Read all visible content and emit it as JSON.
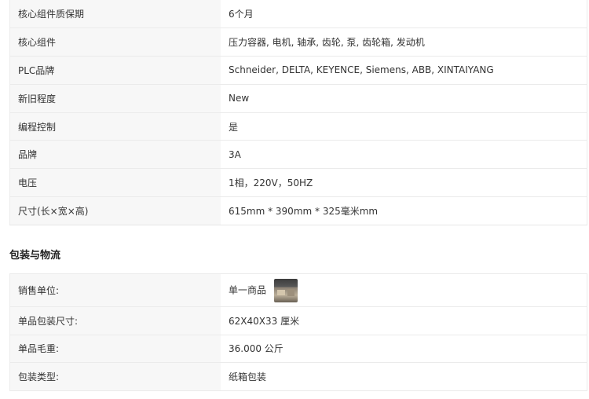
{
  "specs": [
    {
      "key": "核心组件质保期",
      "value": "6个月"
    },
    {
      "key": "核心组件",
      "value": "压力容器, 电机, 轴承, 齿轮, 泵, 齿轮箱, 发动机"
    },
    {
      "key": "PLC品牌",
      "value": "Schneider, DELTA, KEYENCE, Siemens, ABB, XINTAIYANG"
    },
    {
      "key": "新旧程度",
      "value": "New"
    },
    {
      "key": "编程控制",
      "value": "是"
    },
    {
      "key": "品牌",
      "value": "3A"
    },
    {
      "key": "电压",
      "value": "1相，220V，50HZ"
    },
    {
      "key": "尺寸(长×宽×高)",
      "value": "615mm * 390mm * 325毫米mm"
    }
  ],
  "packaging": {
    "title": "包装与物流",
    "rows": [
      {
        "key": "销售单位:",
        "value": "单一商品",
        "has_thumbnail": true
      },
      {
        "key": "单品包装尺寸:",
        "value": "62X40X33 厘米"
      },
      {
        "key": "单品毛重:",
        "value": "36.000 公斤"
      },
      {
        "key": "包装类型:",
        "value": "纸箱包装"
      }
    ]
  }
}
